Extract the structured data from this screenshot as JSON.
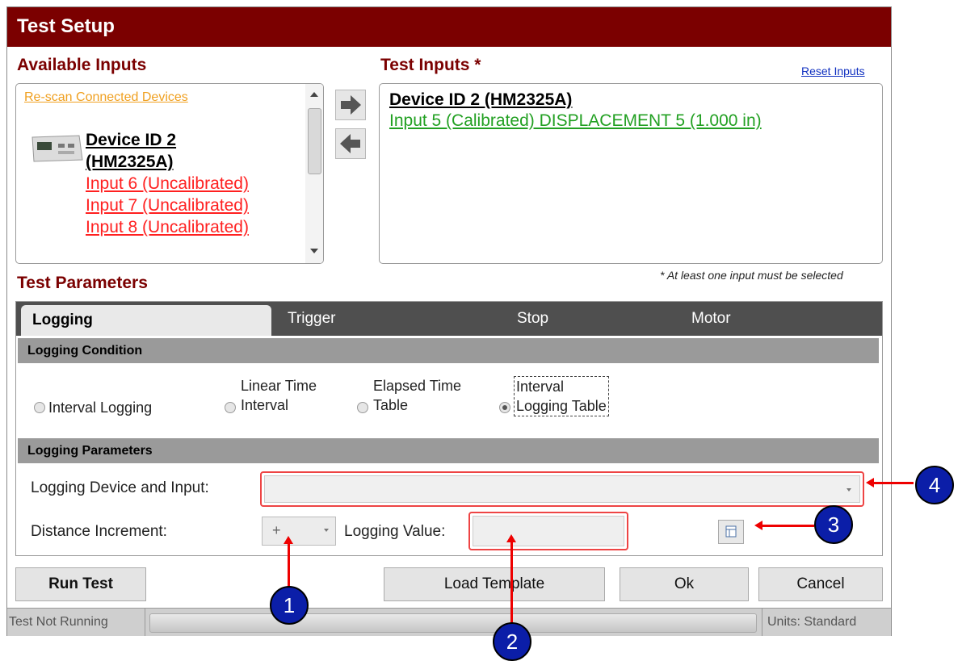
{
  "window": {
    "title": "Test Setup"
  },
  "available_inputs": {
    "heading": "Available Inputs",
    "rescan_link": "Re-scan Connected Devices",
    "device_name_line1": "Device ID 2",
    "device_name_line2": "(HM2325A)",
    "inputs": [
      "Input 6 (Uncalibrated)",
      "Input 7 (Uncalibrated)",
      "Input 8 (Uncalibrated)"
    ]
  },
  "test_inputs": {
    "heading": "Test Inputs *",
    "reset_link": "Reset Inputs",
    "device_name": "Device ID 2 (HM2325A)",
    "selected_input": "Input 5 (Calibrated) DISPLACEMENT 5 (1.000 in)",
    "note": "* At least one input must be selected"
  },
  "test_parameters": {
    "heading": "Test Parameters",
    "tabs": [
      "Logging",
      "Trigger",
      "Stop",
      "Motor"
    ],
    "logging_condition": {
      "title": "Logging Condition",
      "options": [
        {
          "label": "Interval Logging",
          "selected": false
        },
        {
          "label_line1": "Linear Time",
          "label_line2": "Interval",
          "selected": false
        },
        {
          "label_line1": "Elapsed Time",
          "label_line2": "Table",
          "selected": false
        },
        {
          "label_line1": "Interval",
          "label_line2": "Logging Table",
          "selected": true
        }
      ]
    },
    "logging_parameters": {
      "title": "Logging Parameters",
      "device_input_label": "Logging Device and Input:",
      "device_input_value": "",
      "distance_increment_label": "Distance Increment:",
      "distance_increment_value": "+",
      "logging_value_label": "Logging Value:",
      "logging_value": ""
    }
  },
  "buttons": {
    "run_test": "Run Test",
    "load_template": "Load Template",
    "ok": "Ok",
    "cancel": "Cancel"
  },
  "status_bar": {
    "left": "Test Not Running",
    "right": "Units:  Standard"
  },
  "annotations": [
    "1",
    "2",
    "3",
    "4"
  ],
  "colors": {
    "title_bar": "#7b0000",
    "heading": "#7b0000",
    "callout": "#0b1ea8",
    "highlight": "#e00000"
  }
}
